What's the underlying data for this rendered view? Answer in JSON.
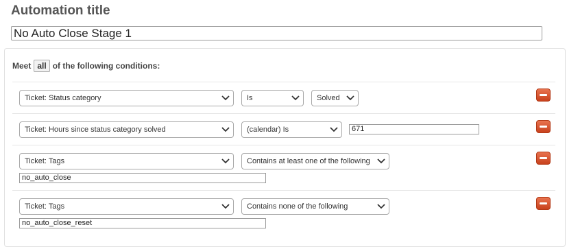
{
  "automation": {
    "title_label": "Automation title",
    "title_value": "No Auto Close Stage 1"
  },
  "conditions": {
    "meet_prefix": "Meet",
    "meet_value": "all",
    "meet_suffix": "of the following conditions:",
    "rows": [
      {
        "field": "Ticket: Status category",
        "operator": "Is",
        "value": "Solved"
      },
      {
        "field": "Ticket: Hours since status category solved",
        "operator": "(calendar) Is",
        "value": "671"
      },
      {
        "field": "Ticket: Tags",
        "operator": "Contains at least one of the following",
        "value": "no_auto_close"
      },
      {
        "field": "Ticket: Tags",
        "operator": "Contains none of the following",
        "value": "no_auto_close_reset"
      }
    ]
  },
  "icons": {
    "chevron": "chevron-down-icon",
    "remove": "minus-icon"
  },
  "colors": {
    "remove_button": "#d9552f",
    "title": "#555555"
  }
}
